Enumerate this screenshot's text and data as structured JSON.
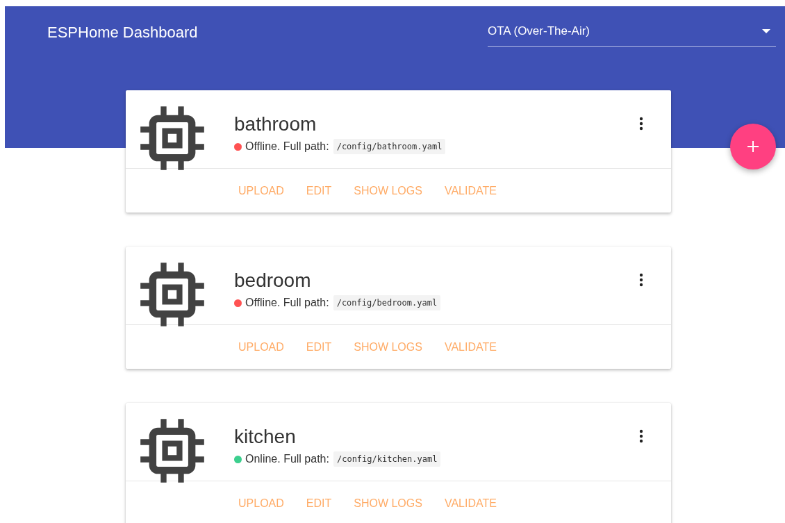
{
  "header": {
    "title": "ESPHome Dashboard",
    "upload_mode": {
      "value": "OTA (Over-The-Air)"
    }
  },
  "devices": [
    {
      "name": "bathroom",
      "status": "Offline. Full path:",
      "color": "#ff5252",
      "path": "/config/bathroom.yaml",
      "actions": [
        "UPLOAD",
        "EDIT",
        "SHOW LOGS",
        "VALIDATE"
      ]
    },
    {
      "name": "bedroom",
      "status": "Offline. Full path:",
      "color": "#ff5252",
      "path": "/config/bedroom.yaml",
      "actions": [
        "UPLOAD",
        "EDIT",
        "SHOW LOGS",
        "VALIDATE"
      ]
    },
    {
      "name": "kitchen",
      "status": "Online. Full path:",
      "color": "#3ccf8e",
      "path": "/config/kitchen.yaml",
      "actions": [
        "UPLOAD",
        "EDIT",
        "SHOW LOGS",
        "VALIDATE"
      ]
    }
  ]
}
